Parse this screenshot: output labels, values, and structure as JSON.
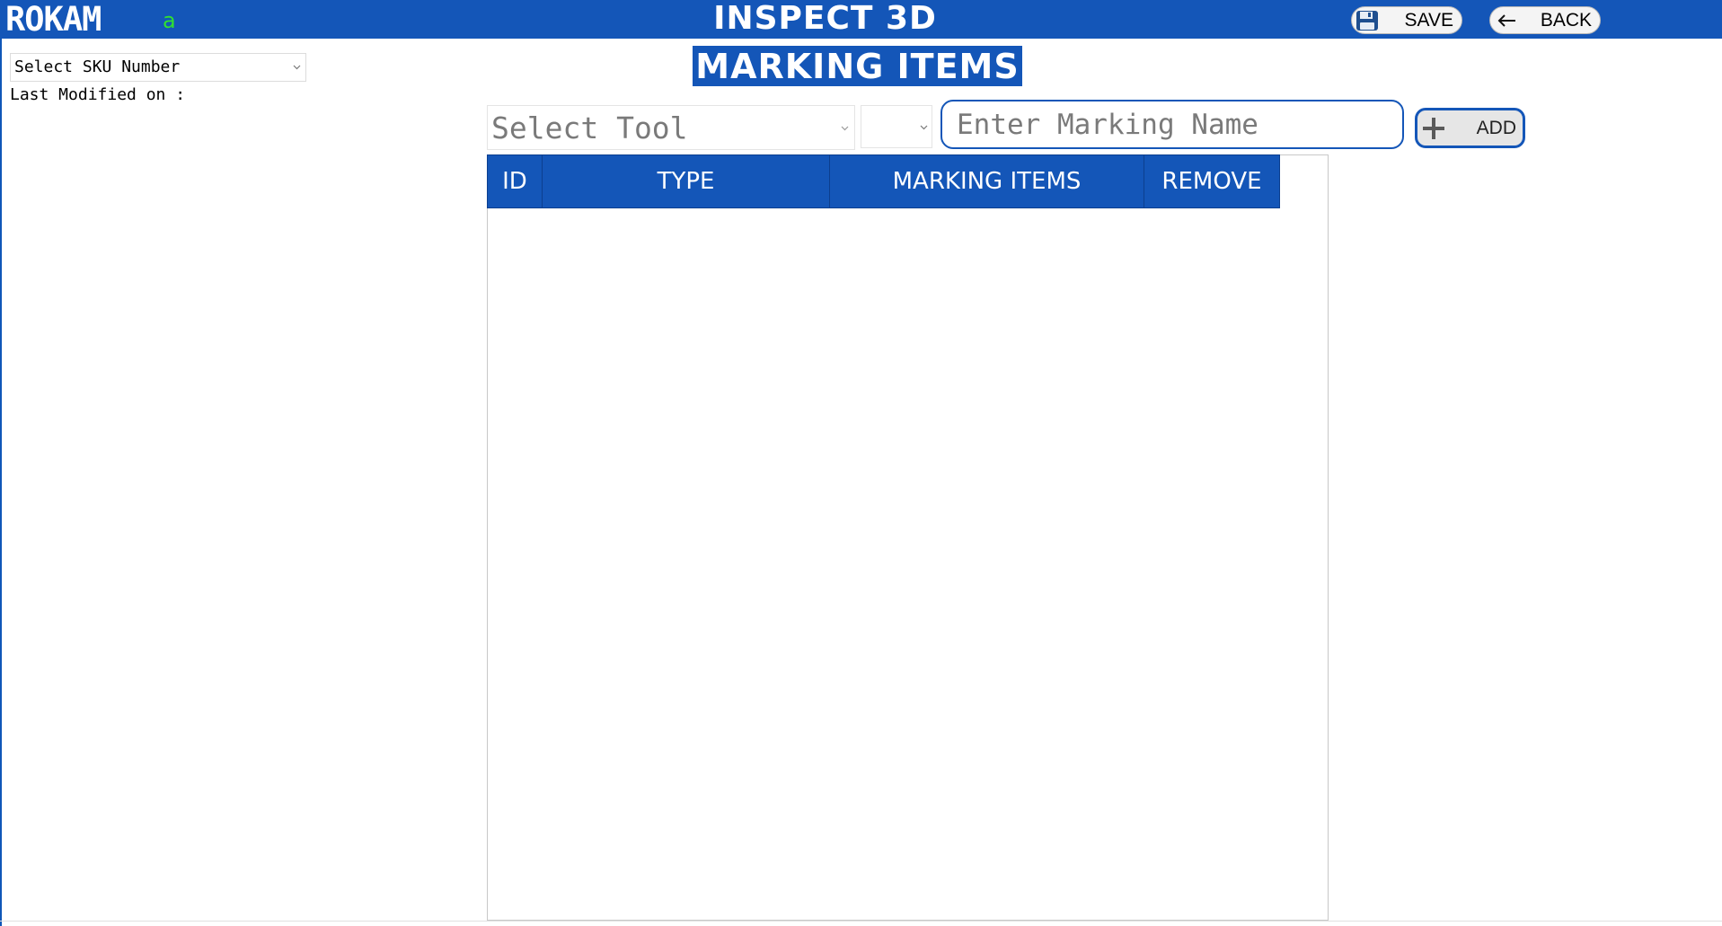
{
  "header": {
    "logo_text": "ROKAM",
    "user_tag": "a",
    "app_title": "INSPECT 3D",
    "save_label": "SAVE",
    "back_label": "BACK",
    "save_icon": "floppy-disk-icon",
    "back_icon": "arrow-left-icon"
  },
  "sidebar": {
    "sku_select": {
      "selected": "Select SKU Number"
    },
    "last_modified_label": "Last Modified on :",
    "last_modified_value": ""
  },
  "main": {
    "section_title": "MARKING ITEMS",
    "tool_select": {
      "selected": "Select Tool"
    },
    "sub_select": {
      "selected": ""
    },
    "marking_name": {
      "value": "",
      "placeholder": "Enter Marking Name"
    },
    "add_label": "ADD",
    "add_icon": "plus-icon",
    "table": {
      "columns": [
        "ID",
        "TYPE",
        "MARKING ITEMS",
        "REMOVE"
      ],
      "rows": []
    }
  },
  "colors": {
    "primary": "#1456b8",
    "user_tag": "#30e030",
    "placeholder": "#7a7a7a"
  }
}
